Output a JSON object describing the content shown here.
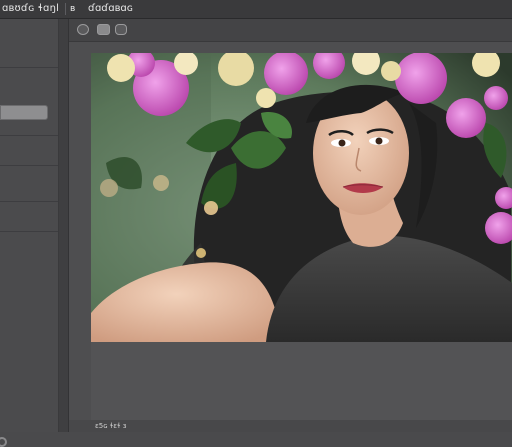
{
  "app": {
    "title_left": "ɑʙʊɗɢ ɬɑŋl",
    "icon_b": "ʙ",
    "title_right": "ɗɑɗɑʙɑɢ"
  },
  "toolbar": {
    "buttons": [
      {
        "icon": "circle-icon"
      },
      {
        "icon": "rect-icon"
      },
      {
        "icon": "rounded-rect-icon"
      }
    ]
  },
  "photo": {
    "subject": "",
    "colors": {
      "background": "#6b8a6a",
      "foliage": "#2f5a2a",
      "flower_pink": "#d25ac8",
      "flower_cream": "#efe3b0",
      "hair": "#262626",
      "skin": "#e9c2a8",
      "shirt": "#3a3a3a"
    }
  },
  "status": {
    "text": "ɛ5ɢ ɬɛɬ ɜ"
  },
  "colors": {
    "window_bg": "#4a4a4c",
    "panel_bg": "#4b4b4d",
    "toolbar_bg": "#444446"
  }
}
